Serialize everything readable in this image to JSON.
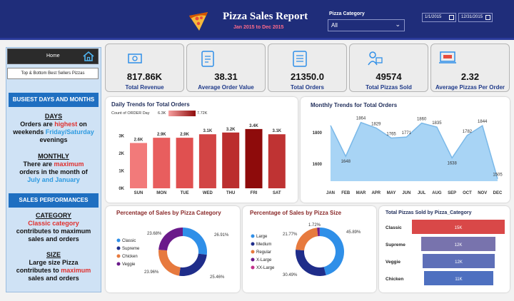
{
  "header": {
    "title": "Pizza Sales Report",
    "subtitle": "Jan 2015 to Dec 2015",
    "category_label": "Pizza Category",
    "category_value": "All",
    "date_from": "1/1/2015",
    "date_to": "12/31/2015"
  },
  "sidebar": {
    "home_label": "Home",
    "top_bottom_label": "Top & Bottom Best Sellers Pizzas",
    "busiest_title": "BUSIEST DAYS AND MONTHS",
    "days_head": "DAYS",
    "days_l1a": "Orders are ",
    "days_l1b": "highest",
    "days_l1c": " on",
    "days_l2a": "weekends ",
    "days_l2b": "Friday/Saturday",
    "days_l3": "evenings",
    "monthly_head": "MONTHLY",
    "monthly_l1": "There are ",
    "monthly_l1b": "maximum",
    "monthly_l2": "orders in the month of",
    "monthly_l3": "July and January",
    "perf_title": "SALES PERFORMANCES",
    "cat_head": "CATEGORY",
    "cat_l1": "Classic category",
    "cat_l2": "contributes to maximum",
    "cat_l3": "sales and orders",
    "size_head": "SIZE",
    "size_l1": "Large size Pizza",
    "size_l2": "contributes to ",
    "size_l2b": "maximum",
    "size_l3": "sales and orders"
  },
  "kpis": [
    {
      "value": "817.86K",
      "label": "Total Revenue",
      "icon": "money-icon"
    },
    {
      "value": "38.31",
      "label": "Average Order Value",
      "icon": "clipboard-icon"
    },
    {
      "value": "21350.0",
      "label": "Total Orders",
      "icon": "order-list-icon"
    },
    {
      "value": "49574",
      "label": "Total Pizzas Sold",
      "icon": "delivery-icon"
    },
    {
      "value": "2.32",
      "label": "Average Pizzas Per Order",
      "icon": "laptop-icon"
    }
  ],
  "daily": {
    "title": "Daily Trends for Total Orders",
    "legend_label": "Count of ORDER Day",
    "legend_min": "6.3K",
    "legend_max": "7.72K"
  },
  "monthly": {
    "title": "Monthly Trends for Total Orders"
  },
  "pie_cat": {
    "title": "Percentage of Sales by Pizza Category"
  },
  "pie_size": {
    "title": "Percentage of Sales by Pizza Size"
  },
  "hbar": {
    "title": "Total Pizzas Sold by Pizza_Category"
  },
  "chart_data": [
    {
      "type": "bar",
      "title": "Daily Trends for Total Orders",
      "categories": [
        "SUN",
        "MON",
        "TUE",
        "WED",
        "THU",
        "FRI",
        "SAT"
      ],
      "values": [
        2.6,
        2.9,
        2.9,
        3.1,
        3.2,
        3.4,
        3.1
      ],
      "data_labels": [
        "2.6K",
        "2.9K",
        "2.9K",
        "3.1K",
        "3.2K",
        "3.4K",
        "3.1K"
      ],
      "yticks": [
        "0K",
        "1K",
        "2K",
        "3K"
      ],
      "ylim": [
        0,
        3.6
      ],
      "colors": [
        "#f27a7a",
        "#e85e5e",
        "#e05050",
        "#d24545",
        "#bb2e2e",
        "#8e0b0b",
        "#bf3333"
      ]
    },
    {
      "type": "area",
      "title": "Monthly Trends for Total Orders",
      "categories": [
        "JAN",
        "FEB",
        "MAR",
        "APR",
        "MAY",
        "JUN",
        "JUL",
        "AUG",
        "SEP",
        "OCT",
        "NOV",
        "DEC"
      ],
      "values": [
        1845,
        1648,
        1864,
        1829,
        1765,
        1771,
        1860,
        1835,
        1638,
        1782,
        1844,
        1505
      ],
      "data_labels": [
        "",
        "1648",
        "1864",
        "1829",
        "1765",
        "1771",
        "1860",
        "1835",
        "1638",
        "1782",
        "1844",
        "1505"
      ],
      "yticks": [
        "1600",
        "1800"
      ],
      "ylim": [
        1490,
        1890
      ],
      "color": "#a8d4f5"
    },
    {
      "type": "pie",
      "title": "Percentage of Sales by Pizza Category",
      "labels": [
        "Classic",
        "Supreme",
        "Chicken",
        "Veggie"
      ],
      "values": [
        26.91,
        25.46,
        23.96,
        23.68
      ],
      "data_labels": [
        "26.91%",
        "25.46%",
        "23.96%",
        "23.68%"
      ],
      "colors": [
        "#2f8fe8",
        "#1f2d8a",
        "#e77a3e",
        "#6a1a8a"
      ]
    },
    {
      "type": "pie",
      "title": "Percentage of Sales by Pizza Size",
      "labels": [
        "Large",
        "Medium",
        "Regular",
        "X-Large",
        "XX-Large"
      ],
      "values": [
        45.89,
        30.49,
        21.77,
        1.72,
        0.12
      ],
      "data_labels": [
        "45.89%",
        "30.49%",
        "21.77%",
        "1.72%",
        ""
      ],
      "colors": [
        "#2f8fe8",
        "#1f2d8a",
        "#e77a3e",
        "#6a1a8a",
        "#c2308a"
      ]
    },
    {
      "type": "bar",
      "title": "Total Pizzas Sold by Pizza_Category",
      "categories": [
        "Classic",
        "Supreme",
        "Veggie",
        "Chicken"
      ],
      "values": [
        15,
        12,
        12,
        11
      ],
      "data_labels": [
        "15K",
        "12K",
        "12K",
        "11K"
      ],
      "colors": [
        "#d94848",
        "#7873ad",
        "#5e6fb8",
        "#4e70c0"
      ]
    }
  ]
}
